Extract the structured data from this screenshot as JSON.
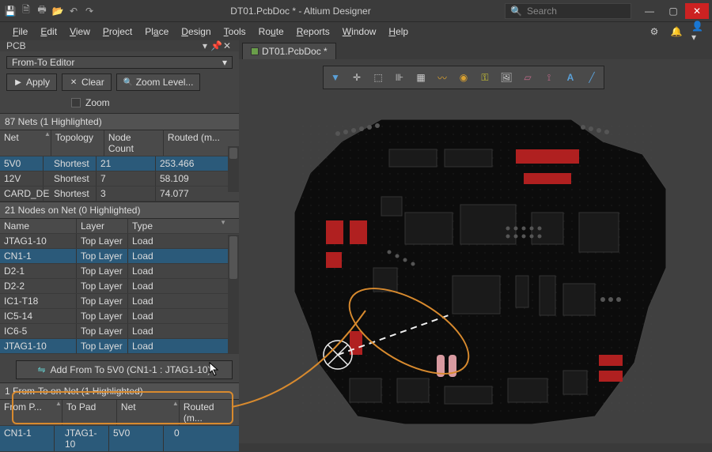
{
  "titlebar": {
    "title": "DT01.PcbDoc * - Altium Designer",
    "search_placeholder": "Search"
  },
  "menus": [
    "File",
    "Edit",
    "View",
    "Project",
    "Place",
    "Design",
    "Tools",
    "Route",
    "Reports",
    "Window",
    "Help"
  ],
  "panel": {
    "title": "PCB",
    "combo": "From-To Editor",
    "apply": "Apply",
    "clear": "Clear",
    "zoom_level": "Zoom Level...",
    "zoom_chk": "Zoom",
    "nets_header": "87 Nets (1 Highlighted)",
    "nets_cols": {
      "net": "Net",
      "topology": "Topology",
      "node_count": "Node Count",
      "routed": "Routed (m..."
    },
    "nets": [
      {
        "net": "5V0",
        "topology": "Shortest",
        "node_count": "21",
        "routed": "253.466"
      },
      {
        "net": "12V",
        "topology": "Shortest",
        "node_count": "7",
        "routed": "58.109"
      },
      {
        "net": "CARD_DE",
        "topology": "Shortest",
        "node_count": "3",
        "routed": "74.077"
      }
    ],
    "nodes_header": "21 Nodes on Net (0 Highlighted)",
    "nodes_cols": {
      "name": "Name",
      "layer": "Layer",
      "type": "Type"
    },
    "nodes": [
      {
        "name": "JTAG1-10",
        "layer": "Top Layer",
        "type": "Load"
      },
      {
        "name": "CN1-1",
        "layer": "Top Layer",
        "type": "Load"
      },
      {
        "name": "D2-1",
        "layer": "Top Layer",
        "type": "Load"
      },
      {
        "name": "D2-2",
        "layer": "Top Layer",
        "type": "Load"
      },
      {
        "name": "IC1-T18",
        "layer": "Top Layer",
        "type": "Load"
      },
      {
        "name": "IC5-14",
        "layer": "Top Layer",
        "type": "Load"
      },
      {
        "name": "IC6-5",
        "layer": "Top Layer",
        "type": "Load"
      },
      {
        "name": "JTAG1-10",
        "layer": "Top Layer",
        "type": "Load"
      }
    ],
    "add_btn": "Add From To 5V0 (CN1-1 : JTAG1-10)",
    "fromtos_header": "1 From-To on Net (1 Highlighted)",
    "ft_cols": {
      "from": "From P...",
      "to": "To Pad",
      "net": "Net",
      "routed": "Routed (m..."
    },
    "fromtos": [
      {
        "from": "CN1-1",
        "to": "JTAG1-10",
        "net": "5V0",
        "routed": "0"
      }
    ]
  },
  "tabs": {
    "doc": "DT01.PcbDoc *"
  }
}
